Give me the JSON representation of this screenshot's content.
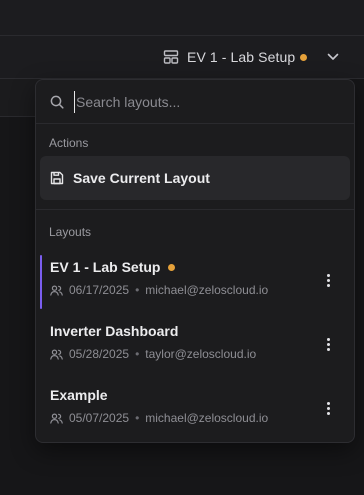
{
  "header": {
    "current_layout": "EV 1 - Lab Setup",
    "unsaved_color": "#e5a13a"
  },
  "dropdown": {
    "search": {
      "placeholder": "Search layouts...",
      "value": ""
    },
    "actions_label": "Actions",
    "actions": [
      {
        "label": "Save Current Layout",
        "icon": "save-icon"
      }
    ],
    "layouts_label": "Layouts",
    "layouts": [
      {
        "name": "EV 1 - Lab Setup",
        "date": "06/17/2025",
        "user": "michael@zeloscloud.io",
        "active": true,
        "unsaved": true
      },
      {
        "name": "Inverter Dashboard",
        "date": "05/28/2025",
        "user": "taylor@zeloscloud.io",
        "active": false,
        "unsaved": false
      },
      {
        "name": "Example",
        "date": "05/07/2025",
        "user": "michael@zeloscloud.io",
        "active": false,
        "unsaved": false
      }
    ],
    "separator": "•"
  },
  "colors": {
    "accent": "#7b5ef0",
    "unsaved_dot": "#e5a13a"
  }
}
